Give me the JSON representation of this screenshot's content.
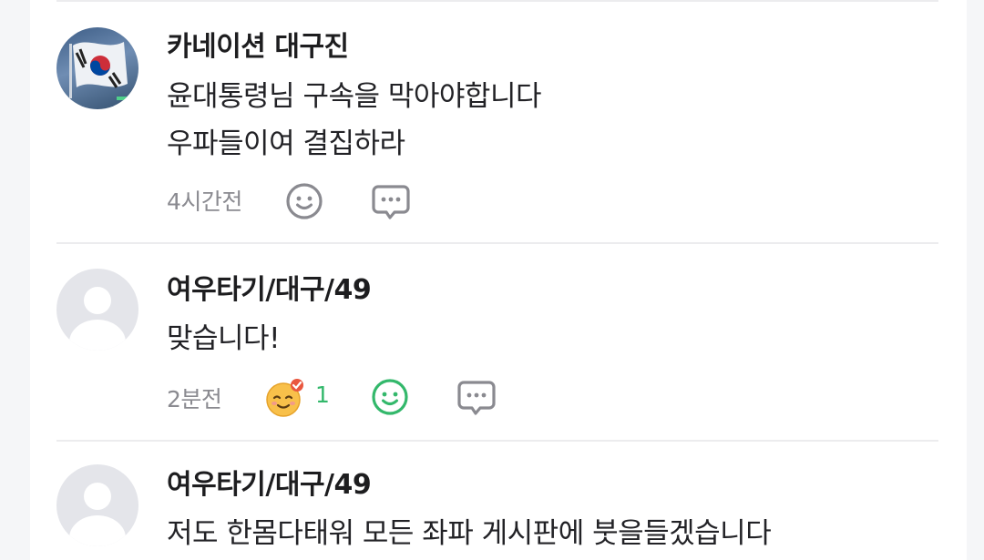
{
  "comments": [
    {
      "author": "카네이션 대구진",
      "lines": [
        "윤대통령님 구속을 막아야합니다",
        "우파들이여 결집하라"
      ],
      "time": "4시간전"
    },
    {
      "author": "여우타기/대구/49",
      "lines": [
        "맞습니다!"
      ],
      "time": "2분전",
      "reaction_count": "1"
    },
    {
      "author": "여우타기/대구/49",
      "lines": [
        "저도 한몸다태워 모든 좌파 게시판에 붓을들겠습니다"
      ]
    }
  ],
  "colors": {
    "icon_gray": "#8a8a90",
    "reaction_green": "#33b86b",
    "divider": "#ececee"
  },
  "icons": {
    "react": "smiley-icon",
    "reply": "speech-bubble-icon",
    "sticker": "ok-emoji-sticker"
  }
}
